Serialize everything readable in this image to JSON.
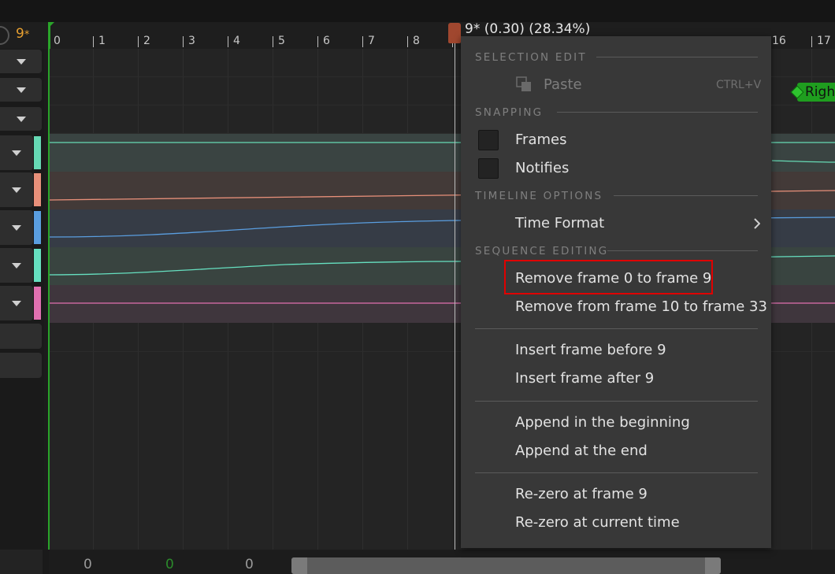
{
  "colors": {
    "accent_orange": "#e8a030",
    "highlight_red": "#e00000",
    "notify_green": "#1f9e1f",
    "track_teal": "#66d9b4",
    "track_salmon": "#e8907a",
    "track_blue": "#5a9ee0",
    "track_teal2": "#66e0c0",
    "track_pink": "#e070b0"
  },
  "header": {
    "current_frame": "9",
    "current_frame_marker": "*"
  },
  "ruler": {
    "ticks": [
      "0",
      "1",
      "2",
      "3",
      "4",
      "5",
      "6",
      "7",
      "8",
      "16",
      "17"
    ]
  },
  "playhead": {
    "label": "9* (0.30) (28.34%)"
  },
  "notify": {
    "label": "Righ"
  },
  "left_panel": {
    "dropdown_icon": "chevron-down-icon"
  },
  "context_menu": {
    "selection_edit": {
      "header": "SELECTION EDIT",
      "paste_label": "Paste",
      "paste_shortcut": "CTRL+V",
      "paste_icon": "paste-icon"
    },
    "snapping": {
      "header": "SNAPPING",
      "frames_label": "Frames",
      "notifies_label": "Notifies"
    },
    "timeline_options": {
      "header": "TIMELINE OPTIONS",
      "time_format_label": "Time Format",
      "submenu_icon": "chevron-right-icon"
    },
    "sequence_editing": {
      "header": "SEQUENCE EDITING",
      "remove_before": "Remove frame 0 to frame 9",
      "remove_after": "Remove from frame 10 to frame 33",
      "insert_before": "Insert frame before 9",
      "insert_after": "Insert frame after 9",
      "append_beginning": "Append in the beginning",
      "append_end": "Append at the end",
      "rezero_frame": "Re-zero at frame 9",
      "rezero_current": "Re-zero at current time"
    }
  },
  "bottom_bar": {
    "value_1": "0",
    "value_2": "0",
    "value_3": "0"
  }
}
